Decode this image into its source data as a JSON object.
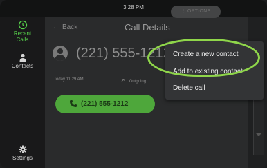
{
  "status": {
    "time": "3:28 PM"
  },
  "sidebar": {
    "items": [
      {
        "label": "Recent Calls",
        "icon": "clock-icon"
      },
      {
        "label": "Contacts",
        "icon": "person-icon"
      },
      {
        "label": "Settings",
        "icon": "gear-icon"
      }
    ]
  },
  "header": {
    "back_label": "Back",
    "title": "Call Details",
    "options_label": "⋮ OPTIONS"
  },
  "contact": {
    "number": "(221) 555-1212"
  },
  "call": {
    "time": "Today 11:29 AM",
    "direction": "Outgoing",
    "button_label": "(221) 555-1212"
  },
  "menu": {
    "items": [
      "Create a new contact",
      "Add to existing contact",
      "Delete call"
    ]
  },
  "colors": {
    "accent": "#57d24b",
    "call_button": "#4ea73b",
    "highlight": "#8fd64a"
  }
}
